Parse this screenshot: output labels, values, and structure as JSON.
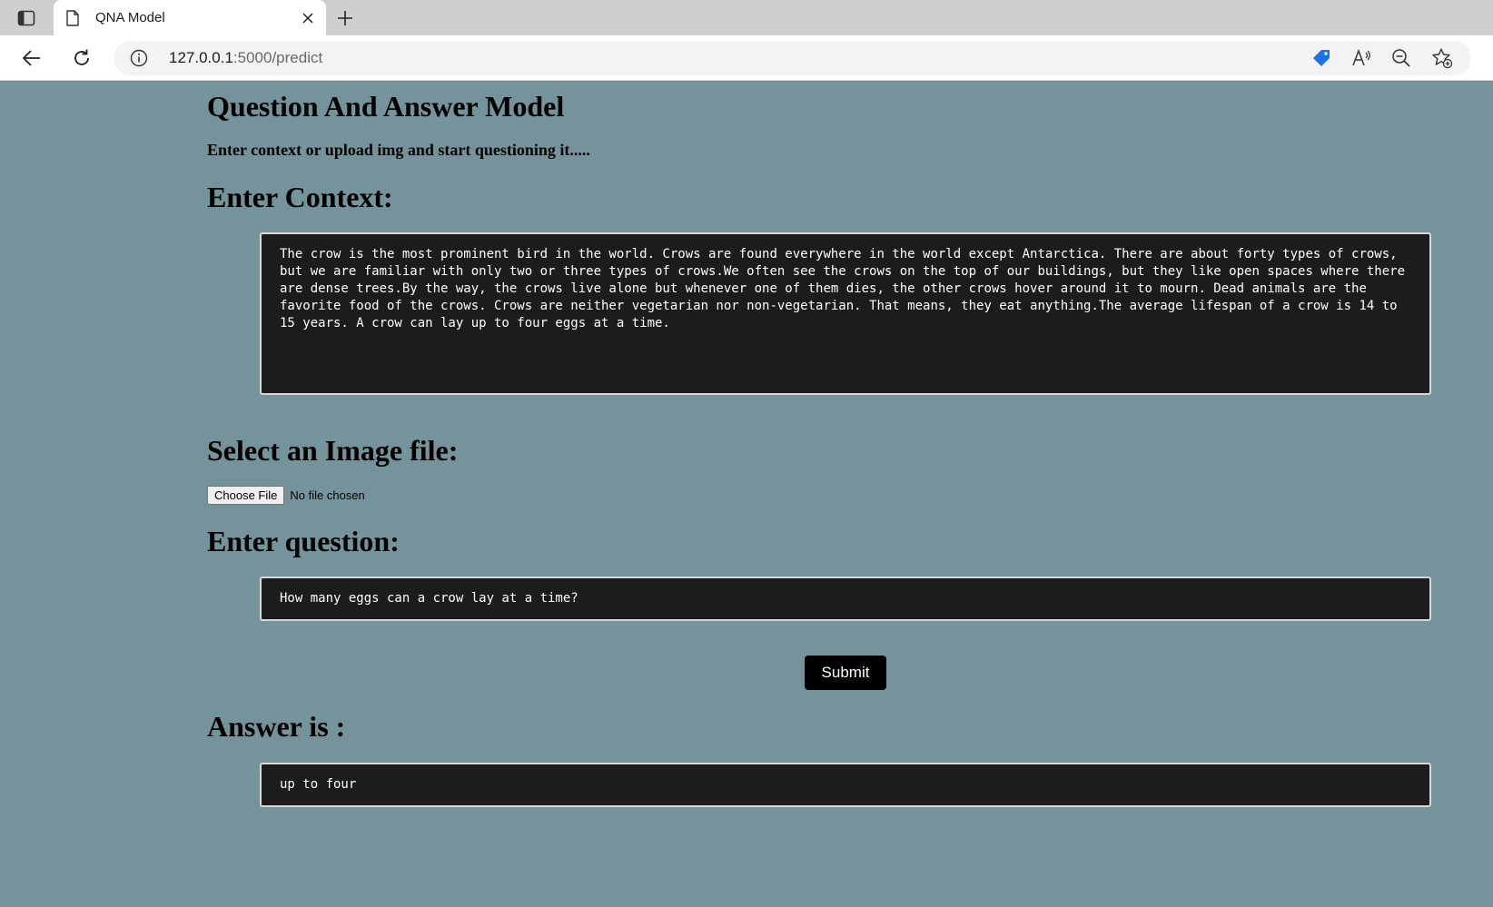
{
  "browser": {
    "tab_title": "QNA Model",
    "url_host": "127.0.0.1",
    "url_path": ":5000/predict",
    "icons": {
      "tab_actions": "tab-actions-icon",
      "tab_page": "document-icon",
      "tab_close": "close-icon",
      "new_tab": "plus-icon",
      "back": "arrow-left-icon",
      "reload": "reload-icon",
      "site_info": "info-icon",
      "shopping": "tag-icon",
      "read_aloud": "read-aloud-icon",
      "zoom_out": "zoom-out-icon",
      "favorites": "star-add-icon"
    },
    "accent_color": "#1a73e8"
  },
  "page": {
    "background_color": "#75939b",
    "title": "Question And Answer Model",
    "subtitle": "Enter context or upload img and start questioning it.....",
    "context_heading": "Enter Context:",
    "context_text": "The crow is the most prominent bird in the world. Crows are found everywhere in the world except Antarctica. There are about forty types of crows, but we are familiar with only two or three types of crows.We often see the crows on the top of our buildings, but they like open spaces where there are dense trees.By the way, the crows live alone but whenever one of them dies, the other crows hover around it to mourn. Dead animals are the favorite food of the crows. Crows are neither vegetarian nor non-vegetarian. That means, they eat anything.The average lifespan of a crow is 14 to 15 years. A crow can lay up to four eggs at a time.",
    "image_heading": "Select an Image file:",
    "choose_file_label": "Choose File",
    "file_status": "No file chosen",
    "question_heading": "Enter question:",
    "question_text": "How many eggs can a crow lay at a time?",
    "submit_label": "Submit",
    "answer_heading": "Answer is :",
    "answer_text": "up to four"
  }
}
